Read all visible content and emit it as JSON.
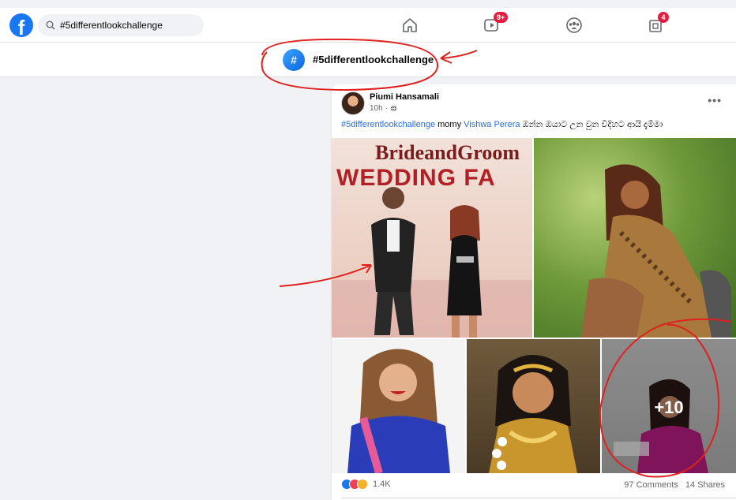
{
  "nav": {
    "logo": "f",
    "search_value": "#5differentlookchallenge",
    "watch_badge": "9+",
    "pages_badge": "4",
    "icons": [
      "home-icon",
      "watch-icon",
      "groups-icon",
      "pages-icon"
    ]
  },
  "hashtag": {
    "symbol": "#",
    "title": "#5differentlookchallenge"
  },
  "post": {
    "author": "Piumi Hansamali",
    "time": "10h",
    "caption_tag": "#5differentlookchallenge",
    "caption_mid": "momy",
    "caption_mention": "Vishwa Perera",
    "caption_tail": "ඔන්න ඔයාට උන වුන විදිහට ආයි දැම්මා",
    "photo1_line1": "BrideandGroom",
    "photo1_line2": "WEDDING FA",
    "more_photos": "+10",
    "reactions_count": "1.4K",
    "comments": "97 Comments",
    "shares": "14 Shares"
  },
  "colors": {
    "brand": "#1877f2",
    "badge": "#e41e3f",
    "link": "#216fdb",
    "annotation": "#e0201e"
  }
}
